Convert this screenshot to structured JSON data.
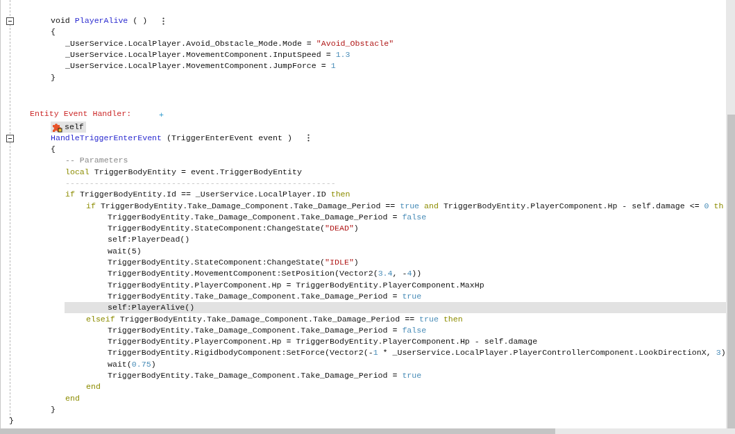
{
  "code": [
    {
      "kind": "group",
      "children": [
        {
          "kind": "group",
          "children": [
            {
              "kind": "line",
              "expanded": true,
              "menu": true,
              "tokens": [
                {
                  "text": "void ",
                  "kind": "plain"
                },
                {
                  "text": "PlayerAlive",
                  "kind": "function"
                },
                {
                  "text": " ( )",
                  "kind": "plain"
                }
              ]
            },
            {
              "kind": "line",
              "tokens": [
                {
                  "text": "{",
                  "kind": "plain"
                }
              ]
            },
            {
              "kind": "group",
              "children": [
                {
                  "kind": "line",
                  "tokens": [
                    {
                      "text": "_UserService.LocalPlayer.Avoid_Obstacle_Mode.Mode = ",
                      "kind": "plain"
                    },
                    {
                      "text": "\"Avoid_Obstacle\"",
                      "kind": "string"
                    }
                  ]
                },
                {
                  "kind": "line",
                  "tokens": [
                    {
                      "text": "_UserService.LocalPlayer.MovementComponent.InputSpeed = ",
                      "kind": "plain"
                    },
                    {
                      "text": "1.3",
                      "kind": "literal"
                    }
                  ]
                },
                {
                  "kind": "line",
                  "tokens": [
                    {
                      "text": "_UserService.LocalPlayer.MovementComponent.JumpForce = ",
                      "kind": "plain"
                    },
                    {
                      "text": "1",
                      "kind": "literal"
                    }
                  ]
                }
              ]
            },
            {
              "kind": "line",
              "tokens": [
                {
                  "text": "}",
                  "kind": "plain"
                }
              ]
            }
          ]
        },
        {
          "kind": "blank"
        },
        {
          "kind": "blank"
        },
        {
          "kind": "line",
          "add": "+",
          "tokens": [
            {
              "text": "Entity Event Handler:",
              "kind": "label"
            }
          ],
          "children": [
            {
              "kind": "object",
              "text": "self"
            },
            {
              "kind": "line",
              "expanded": true,
              "menu": true,
              "tokens": [
                {
                  "text": "HandleTriggerEnterEvent",
                  "kind": "function"
                },
                {
                  "text": " (TriggerEnterEvent event )",
                  "kind": "plain"
                }
              ]
            },
            {
              "kind": "line",
              "tokens": [
                {
                  "text": "{",
                  "kind": "plain"
                }
              ]
            },
            {
              "kind": "group",
              "children": [
                {
                  "kind": "line",
                  "tokens": [
                    {
                      "text": "-- Parameters",
                      "kind": "comment"
                    }
                  ]
                },
                {
                  "kind": "line",
                  "tokens": [
                    {
                      "text": "local",
                      "kind": "keyword"
                    },
                    {
                      "text": " TriggerBodyEntity = event.TriggerBodyEntity",
                      "kind": "plain"
                    }
                  ]
                },
                {
                  "kind": "line",
                  "tokens": [
                    {
                      "text": "--------------------------------------------------------",
                      "kind": "rule"
                    }
                  ]
                },
                {
                  "kind": "line",
                  "tokens": [
                    {
                      "text": "if",
                      "kind": "keyword"
                    },
                    {
                      "text": " TriggerBodyEntity.Id == _UserService.LocalPlayer.ID ",
                      "kind": "plain"
                    },
                    {
                      "text": "then",
                      "kind": "keyword"
                    }
                  ],
                  "children": [
                    {
                      "kind": "line",
                      "tokens": [
                        {
                          "text": "if",
                          "kind": "keyword"
                        },
                        {
                          "text": " TriggerBodyEntity.Take_Damage_Component.Take_Damage_Period == ",
                          "kind": "plain"
                        },
                        {
                          "text": "true",
                          "kind": "literal"
                        },
                        {
                          "text": " and",
                          "kind": "keyword"
                        },
                        {
                          "text": " TriggerBodyEntity.PlayerComponent.Hp - self.damage <= ",
                          "kind": "plain"
                        },
                        {
                          "text": "0",
                          "kind": "literal"
                        },
                        {
                          "text": " th",
                          "kind": "keyword"
                        }
                      ],
                      "children": [
                        {
                          "kind": "line",
                          "tokens": [
                            {
                              "text": "TriggerBodyEntity.Take_Damage_Component.Take_Damage_Period = ",
                              "kind": "plain"
                            },
                            {
                              "text": "false",
                              "kind": "literal"
                            }
                          ]
                        },
                        {
                          "kind": "line",
                          "tokens": [
                            {
                              "text": "TriggerBodyEntity.StateComponent:ChangeState(",
                              "kind": "plain"
                            },
                            {
                              "text": "\"DEAD\"",
                              "kind": "string"
                            },
                            {
                              "text": ")",
                              "kind": "plain"
                            }
                          ]
                        },
                        {
                          "kind": "line",
                          "tokens": [
                            {
                              "text": "self:PlayerDead()",
                              "kind": "plain"
                            }
                          ]
                        },
                        {
                          "kind": "line",
                          "tokens": [
                            {
                              "text": "wait(5)",
                              "kind": "plain"
                            }
                          ]
                        },
                        {
                          "kind": "line",
                          "tokens": [
                            {
                              "text": "TriggerBodyEntity.StateComponent:ChangeState(",
                              "kind": "plain"
                            },
                            {
                              "text": "\"IDLE\"",
                              "kind": "string"
                            },
                            {
                              "text": ")",
                              "kind": "plain"
                            }
                          ]
                        },
                        {
                          "kind": "line",
                          "tokens": [
                            {
                              "text": "TriggerBodyEntity.MovementComponent:SetPosition(Vector2(",
                              "kind": "plain"
                            },
                            {
                              "text": "3.4",
                              "kind": "literal"
                            },
                            {
                              "text": ", -",
                              "kind": "plain"
                            },
                            {
                              "text": "4",
                              "kind": "literal"
                            },
                            {
                              "text": "))",
                              "kind": "plain"
                            }
                          ]
                        },
                        {
                          "kind": "line",
                          "tokens": [
                            {
                              "text": "TriggerBodyEntity.PlayerComponent.Hp = TriggerBodyEntity.PlayerComponent.MaxHp",
                              "kind": "plain"
                            }
                          ]
                        },
                        {
                          "kind": "line",
                          "tokens": [
                            {
                              "text": "TriggerBodyEntity.Take_Damage_Component.Take_Damage_Period = ",
                              "kind": "plain"
                            },
                            {
                              "text": "true",
                              "kind": "literal"
                            }
                          ]
                        },
                        {
                          "kind": "line",
                          "highlighted": true,
                          "tokens": [
                            {
                              "text": "self:PlayerAlive()",
                              "kind": "plain"
                            }
                          ]
                        }
                      ]
                    },
                    {
                      "kind": "line",
                      "tokens": [
                        {
                          "text": "elseif",
                          "kind": "keyword"
                        },
                        {
                          "text": " TriggerBodyEntity.Take_Damage_Component.Take_Damage_Period == ",
                          "kind": "plain"
                        },
                        {
                          "text": "true",
                          "kind": "literal"
                        },
                        {
                          "text": " then",
                          "kind": "keyword"
                        }
                      ],
                      "children": [
                        {
                          "kind": "line",
                          "tokens": [
                            {
                              "text": "TriggerBodyEntity.Take_Damage_Component.Take_Damage_Period = ",
                              "kind": "plain"
                            },
                            {
                              "text": "false",
                              "kind": "literal"
                            }
                          ]
                        },
                        {
                          "kind": "line",
                          "tokens": [
                            {
                              "text": "TriggerBodyEntity.PlayerComponent.Hp = TriggerBodyEntity.PlayerComponent.Hp - self.damage",
                              "kind": "plain"
                            }
                          ]
                        },
                        {
                          "kind": "line",
                          "tokens": [
                            {
                              "text": "TriggerBodyEntity.RigidbodyComponent:SetForce(Vector2(-",
                              "kind": "plain"
                            },
                            {
                              "text": "1",
                              "kind": "literal"
                            },
                            {
                              "text": " * _UserService.LocalPlayer.PlayerControllerComponent.LookDirectionX, ",
                              "kind": "plain"
                            },
                            {
                              "text": "3",
                              "kind": "literal"
                            },
                            {
                              "text": ")",
                              "kind": "plain"
                            }
                          ]
                        },
                        {
                          "kind": "line",
                          "tokens": [
                            {
                              "text": "wait(",
                              "kind": "plain"
                            },
                            {
                              "text": "0.75",
                              "kind": "literal"
                            },
                            {
                              "text": ")",
                              "kind": "plain"
                            }
                          ]
                        },
                        {
                          "kind": "line",
                          "tokens": [
                            {
                              "text": "TriggerBodyEntity.Take_Damage_Component.Take_Damage_Period = ",
                              "kind": "plain"
                            },
                            {
                              "text": "true",
                              "kind": "literal"
                            }
                          ]
                        }
                      ]
                    },
                    {
                      "kind": "line",
                      "tokens": [
                        {
                          "text": "end",
                          "kind": "keyword"
                        }
                      ]
                    }
                  ]
                },
                {
                  "kind": "line",
                  "tokens": [
                    {
                      "text": "end",
                      "kind": "keyword"
                    }
                  ]
                }
              ]
            },
            {
              "kind": "line",
              "tokens": [
                {
                  "text": "}",
                  "kind": "plain"
                }
              ]
            }
          ]
        }
      ]
    },
    {
      "kind": "line",
      "tokens": [
        {
          "text": "}",
          "kind": "plain"
        }
      ]
    }
  ]
}
